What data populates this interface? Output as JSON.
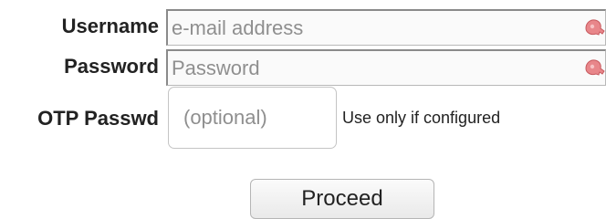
{
  "login_form": {
    "username": {
      "label": "Username",
      "placeholder": "e-mail address",
      "value": "",
      "icon": "password-manager-icon"
    },
    "password": {
      "label": "Password",
      "placeholder": "Password",
      "value": "",
      "icon": "password-manager-icon"
    },
    "otp": {
      "label": "OTP Passwd",
      "placeholder": "(optional)",
      "value": "",
      "hint": "Use only if configured"
    },
    "submit_label": "Proceed",
    "icon_color": "#e8868a"
  }
}
